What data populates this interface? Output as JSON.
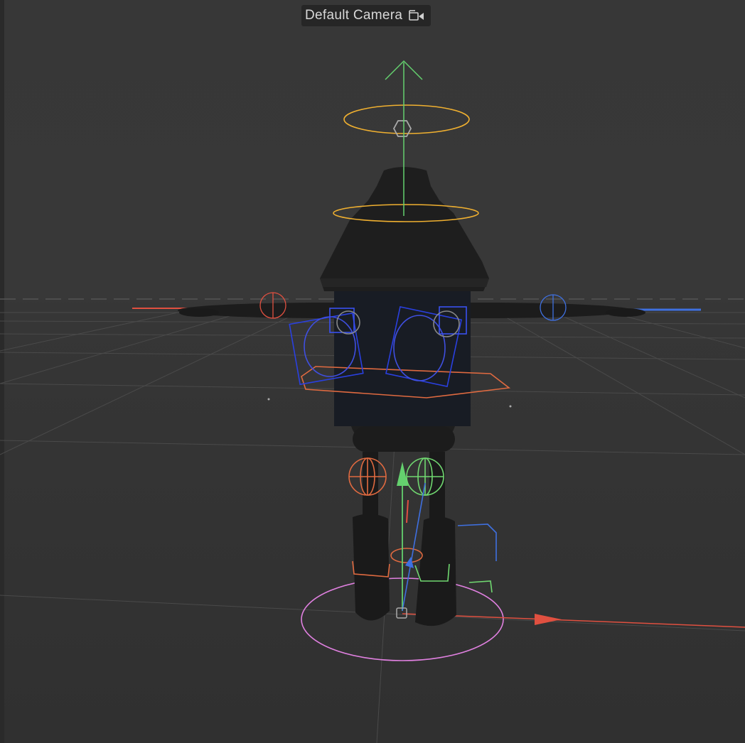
{
  "viewport": {
    "camera_label": "Default Camera",
    "camera_icon": "camera-icon"
  },
  "colors": {
    "background": "#333333",
    "grid": "#4a4a4a",
    "axis_x": "#e05040",
    "axis_y": "#64d06e",
    "axis_z": "#3f6fe0",
    "control_yellow": "#f0b030",
    "control_orange": "#e06a40",
    "control_blue": "#2a40e0",
    "control_pink": "#e080e0",
    "control_green": "#70d870",
    "mesh": "#1e1e1e"
  }
}
